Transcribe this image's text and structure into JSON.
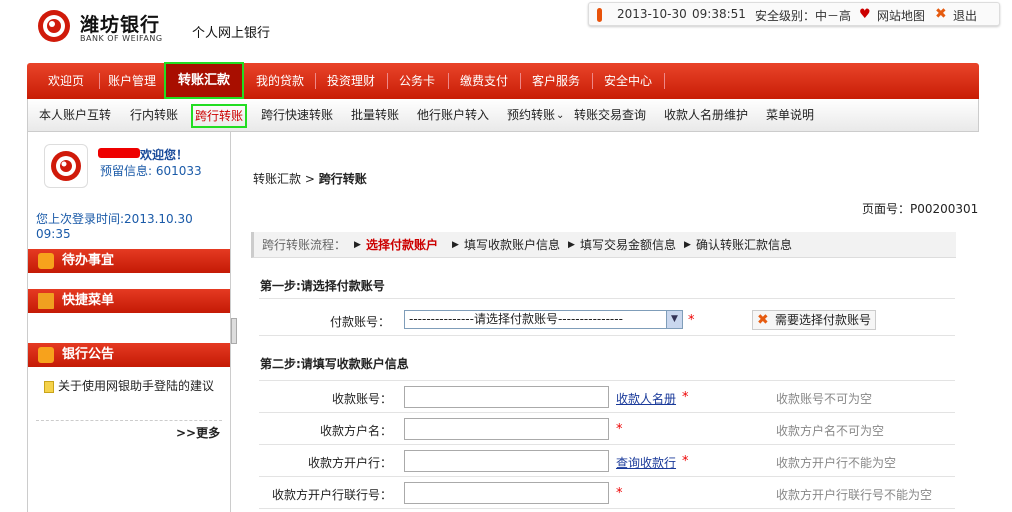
{
  "header": {
    "bank_name": "潍坊银行",
    "bank_en": "BANK OF WEIFANG",
    "subtitle": "个人网上银行",
    "date": "2013-10-30",
    "time": "09:38:51",
    "security_level": "安全级别：中－高",
    "sitemap": "网站地图",
    "logout": "退出"
  },
  "nav_main": {
    "items": [
      "欢迎页",
      "账户管理",
      "转账汇款",
      "我的贷款",
      "投资理财",
      "公务卡",
      "缴费支付",
      "客户服务",
      "安全中心"
    ],
    "active": "转账汇款"
  },
  "nav_sub": {
    "items": [
      "本人账户互转",
      "行内转账",
      "跨行转账",
      "跨行快速转账",
      "批量转账",
      "他行账户转入",
      "预约转账",
      "转账交易查询",
      "收款人名册维护",
      "菜单说明"
    ],
    "active": "跨行转账"
  },
  "sidebar": {
    "welcome": "欢迎您！",
    "reserve_info": "预留信息: 601033",
    "last_login": "您上次登录时间:2013.10.30 09:35",
    "todo": "待办事宜",
    "shortcut": "快捷菜单",
    "notice": "银行公告",
    "notice_item": "关于使用网银助手登陆的建议",
    "more": ">>更多"
  },
  "main": {
    "breadcrumb_parent": "转账汇款",
    "breadcrumb_current": "跨行转账",
    "page_no": "页面号：P00200301",
    "flow_label": "跨行转账流程：",
    "flow_steps": [
      "选择付款账户",
      "填写收款账户信息",
      "填写交易金额信息",
      "确认转账汇款信息"
    ],
    "step1_title": "第一步:请选择付款账号",
    "pay_account_label": "付款账号：",
    "pay_account_value": "---------------请选择付款账号---------------",
    "pay_account_hint": "需要选择付款账号",
    "step2_title": "第二步:请填写收款账户信息",
    "fields": [
      {
        "label": "收款账号：",
        "link": "收款人名册",
        "hint": "收款账号不可为空"
      },
      {
        "label": "收款方户名：",
        "link": "",
        "hint": "收款方户名不可为空"
      },
      {
        "label": "收款方开户行：",
        "link": "查询收款行",
        "hint": "收款方开户行不能为空"
      },
      {
        "label": "收款方开户行联行号：",
        "link": "",
        "hint": "收款方开户行联行号不能为空"
      }
    ],
    "required_mark": "*"
  },
  "colors": {
    "brand_red": "#c81d05",
    "highlight_green": "#22dd22",
    "link_blue": "#1a3a9a"
  }
}
